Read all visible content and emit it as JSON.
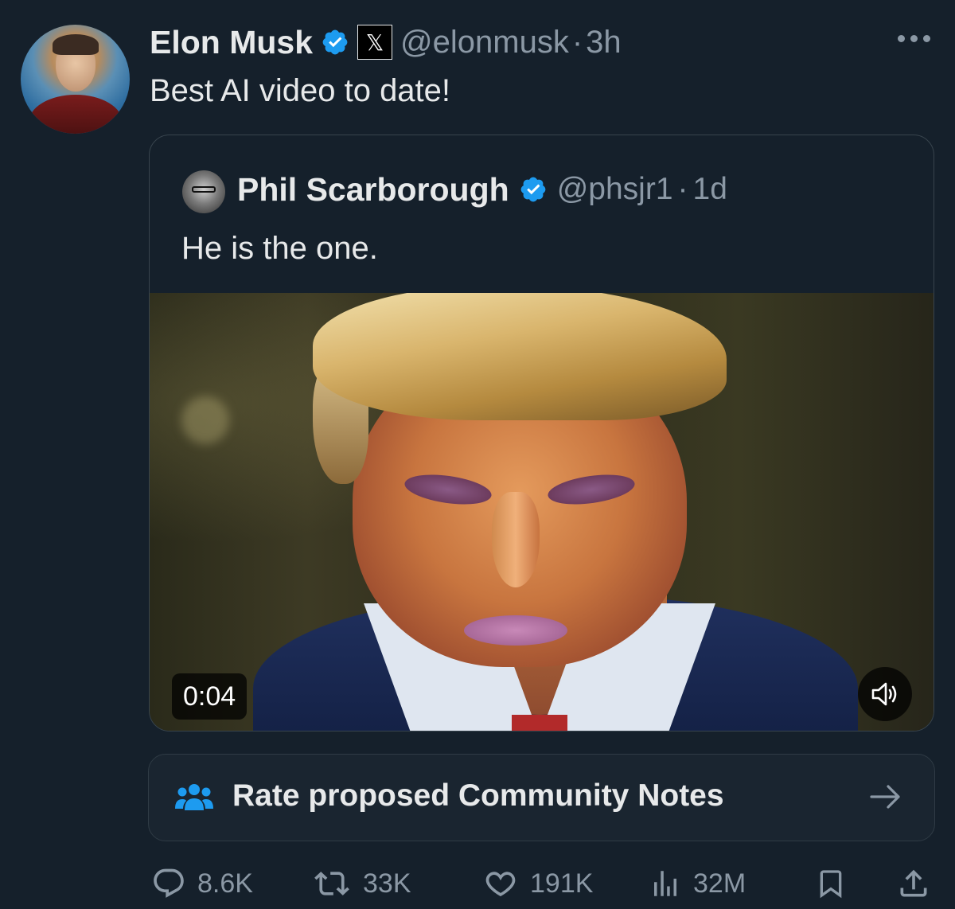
{
  "tweet": {
    "author_name": "Elon Musk",
    "handle": "@elonmusk",
    "separator": "·",
    "time": "3h",
    "badge_x": "𝕏",
    "text": "Best AI video to date!"
  },
  "quoted_tweet": {
    "author_name": "Phil Scarborough",
    "handle": "@phsjr1",
    "separator": "·",
    "time": "1d",
    "text": "He is the one.",
    "video": {
      "timecode": "0:04"
    }
  },
  "community_notes": {
    "label": "Rate proposed Community Notes"
  },
  "actions": {
    "replies": "8.6K",
    "reposts": "33K",
    "likes": "191K",
    "views": "32M"
  },
  "colors": {
    "background": "#15202b",
    "text": "#e7e9ea",
    "muted": "#8b98a5",
    "verified": "#1d9bf0",
    "notes_icon": "#1d9bf0"
  },
  "icons": [
    "verified-icon",
    "x-logo-icon",
    "more-icon",
    "volume-icon",
    "people-icon",
    "arrow-right-icon",
    "reply-icon",
    "repost-icon",
    "like-icon",
    "views-icon",
    "bookmark-icon",
    "share-icon"
  ]
}
